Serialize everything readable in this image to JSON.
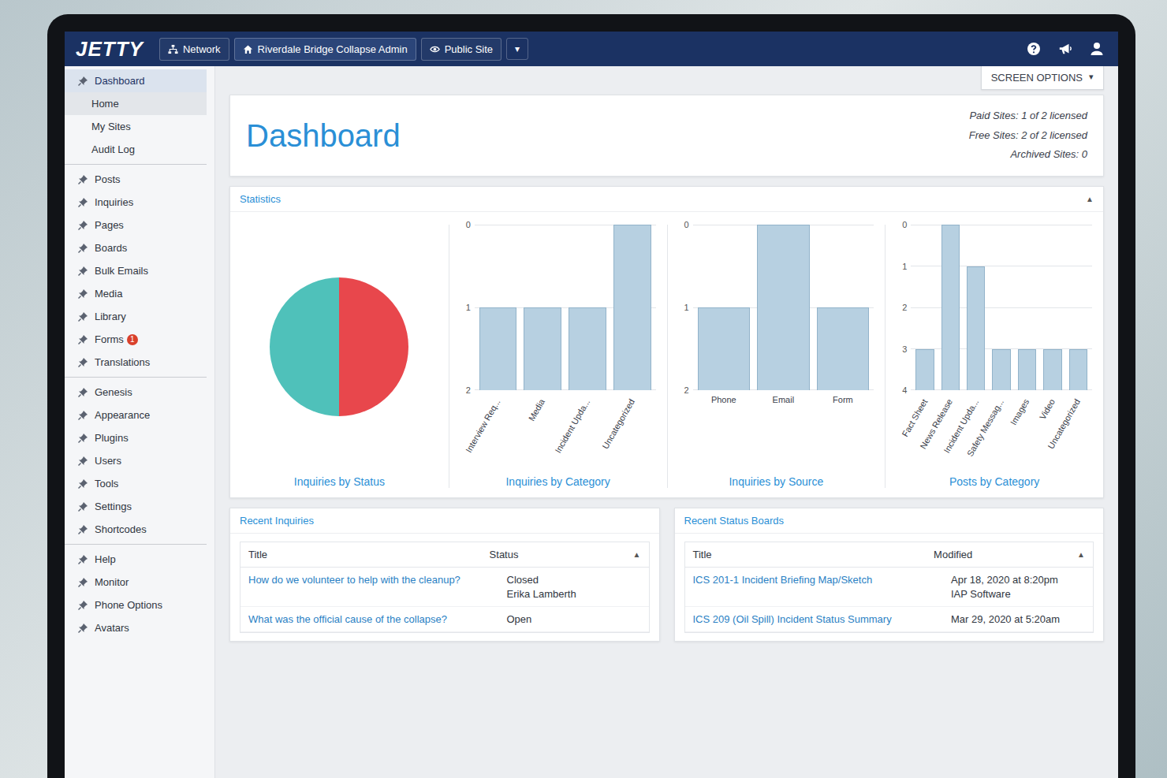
{
  "topbar": {
    "logo": "JETTY",
    "links": [
      {
        "label": "Network",
        "selected": false
      },
      {
        "label": "Riverdale Bridge Collapse Admin",
        "selected": true
      },
      {
        "label": "Public Site",
        "selected": false
      }
    ],
    "dropdown": "▾"
  },
  "sidebar": {
    "groups": [
      [
        {
          "label": "Dashboard",
          "kind": "section",
          "selected": true
        },
        {
          "label": "Home",
          "kind": "sub",
          "selected": true
        },
        {
          "label": "My Sites",
          "kind": "sub",
          "selected": false
        },
        {
          "label": "Audit Log",
          "kind": "sub",
          "selected": false
        }
      ],
      [
        {
          "label": "Posts",
          "kind": "item",
          "selected": false
        },
        {
          "label": "Inquiries",
          "kind": "item",
          "selected": false
        },
        {
          "label": "Pages",
          "kind": "item",
          "selected": false
        },
        {
          "label": "Boards",
          "kind": "item",
          "selected": false
        },
        {
          "label": "Bulk Emails",
          "kind": "item",
          "selected": false
        },
        {
          "label": "Media",
          "kind": "item",
          "selected": false
        },
        {
          "label": "Library",
          "kind": "item",
          "selected": false
        },
        {
          "label": "Forms",
          "kind": "item",
          "selected": false,
          "badge": "1"
        },
        {
          "label": "Translations",
          "kind": "item",
          "selected": false
        }
      ],
      [
        {
          "label": "Genesis",
          "kind": "item",
          "selected": false
        },
        {
          "label": "Appearance",
          "kind": "item",
          "selected": false
        },
        {
          "label": "Plugins",
          "kind": "item",
          "selected": false
        },
        {
          "label": "Users",
          "kind": "item",
          "selected": false
        },
        {
          "label": "Tools",
          "kind": "item",
          "selected": false
        },
        {
          "label": "Settings",
          "kind": "item",
          "selected": false
        },
        {
          "label": "Shortcodes",
          "kind": "item",
          "selected": false
        }
      ],
      [
        {
          "label": "Help",
          "kind": "item",
          "selected": false
        },
        {
          "label": "Monitor",
          "kind": "item",
          "selected": false
        },
        {
          "label": "Phone Options",
          "kind": "item",
          "selected": false
        },
        {
          "label": "Avatars",
          "kind": "item",
          "selected": false
        }
      ]
    ]
  },
  "screen_options": {
    "label": "SCREEN OPTIONS",
    "arrow": "▾"
  },
  "header": {
    "title": "Dashboard",
    "license": [
      "Paid Sites: 1 of 2 licensed",
      "Free Sites: 2 of 2 licensed",
      "Archived Sites: 0"
    ]
  },
  "statistics": {
    "title": "Statistics",
    "collapse": "▲",
    "charts": [
      {
        "kind": "pie",
        "title": "Inquiries by Status",
        "slices": [
          {
            "value": 1,
            "color": "#e8474c"
          },
          {
            "value": 1,
            "color": "#4fc1ba"
          }
        ]
      },
      {
        "kind": "bar-slanted",
        "title": "Inquiries by Category",
        "ticks": [
          "0",
          "1",
          "2"
        ],
        "labels": [
          "Interview Req...",
          "Media",
          "Incident Upda...",
          "Uncategorized"
        ],
        "values": [
          1,
          1,
          1,
          2
        ]
      },
      {
        "kind": "bar",
        "title": "Inquiries by Source",
        "ticks": [
          "0",
          "1",
          "2"
        ],
        "labels": [
          "Phone",
          "Email",
          "Form"
        ],
        "values": [
          1,
          2,
          1
        ]
      },
      {
        "kind": "bar-slanted",
        "title": "Posts by Category",
        "ticks": [
          "0",
          "1",
          "2",
          "3",
          "4"
        ],
        "labels": [
          "Fact Sheet",
          "News Release",
          "Incident Upda...",
          "Safety Messag...",
          "Images",
          "Video",
          "Uncategorized"
        ],
        "values": [
          1,
          4,
          3,
          1,
          1,
          1,
          1
        ]
      }
    ]
  },
  "recent_inquiries": {
    "title": "Recent Inquiries",
    "collapse": "▲",
    "columns": [
      "Title",
      "Status"
    ],
    "rows": [
      {
        "title": "How do we volunteer to help with the cleanup?",
        "status": "Closed",
        "assignee": "Erika Lamberth"
      },
      {
        "title": "What was the official cause of the collapse?",
        "status": "Open"
      }
    ]
  },
  "recent_status_boards": {
    "title": "Recent Status Boards",
    "collapse": "▲",
    "columns": [
      "Title",
      "Modified"
    ],
    "rows": [
      {
        "title": "ICS 201-1 Incident Briefing Map/Sketch",
        "modified": "Apr 18, 2020 at 8:20pm",
        "author": "IAP Software"
      },
      {
        "title": "ICS 209 (Oil Spill) Incident Status Summary",
        "modified": "Mar 29, 2020 at 5:20am"
      }
    ]
  }
}
